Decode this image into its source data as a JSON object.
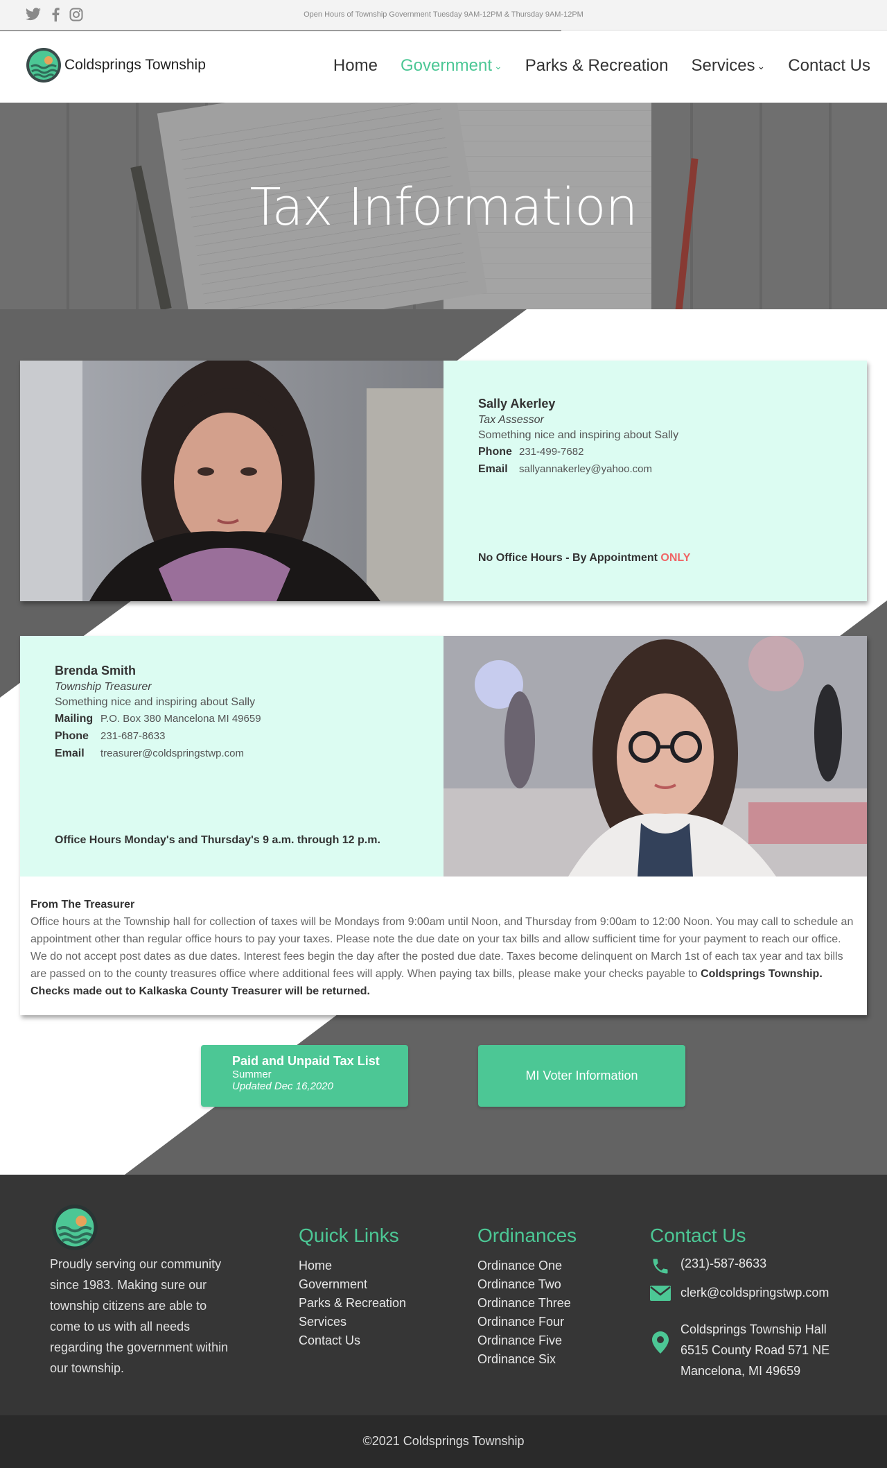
{
  "topbar": {
    "hours": "Open Hours of Township Government Tuesday 9AM-12PM & Thursday 9AM-12PM",
    "social_icons": [
      "twitter-icon",
      "facebook-icon",
      "instagram-icon"
    ]
  },
  "header": {
    "site_name": "Coldsprings Township",
    "nav": [
      {
        "label": "Home"
      },
      {
        "label": "Government"
      },
      {
        "label": "Parks & Recreation"
      },
      {
        "label": "Services"
      },
      {
        "label": "Contact Us"
      }
    ],
    "active_color": "#4cc795"
  },
  "hero": {
    "title": "Tax Information"
  },
  "assessor": {
    "name": "Sally Akerley",
    "role": "Tax Assessor",
    "desc": "Something nice and inspiring about Sally",
    "phone_label": "Phone",
    "phone": "231-499-7682",
    "email_label": "Email",
    "email": "sallyannakerley@yahoo.com",
    "hours_text": "No Office Hours - By Appointment ",
    "hours_emph": "ONLY"
  },
  "treasurer": {
    "name": "Brenda Smith",
    "role": "Township Treasurer",
    "desc": "Something nice and inspiring about Sally",
    "mailing_label": "Mailing",
    "mailing": "P.O. Box 380 Mancelona MI 49659",
    "phone_label": "Phone",
    "phone": "231-687-8633",
    "email_label": "Email",
    "email": "treasurer@coldspringstwp.com",
    "hours_text": "Office Hours Monday's and Thursday's 9 a.m. through 12 p.m."
  },
  "from_treasurer": {
    "title": "From The Treasurer",
    "body": "Office hours at the Township hall for collection of taxes will be Mondays from 9:00am until Noon, and Thursday from 9:00am to 12:00 Noon.  You may call to schedule an appointment other than regular office hours to pay your taxes. Please note the due date on your tax bills and allow sufficient time for your payment to reach our office.  We do not accept post dates as due dates.  Interest fees begin the day after the posted due date.  Taxes become delinquent on March 1st of each  tax year and tax bills are passed on to the county treasures office where additional fees will apply. When paying tax bills, please make your checks payable to ",
    "strong": "Coldsprings Township. Checks made out to Kalkaska County Treasurer will be returned."
  },
  "buttons": {
    "tax_list_title": "Paid and Unpaid Tax List",
    "tax_list_season": "Summer",
    "tax_list_updated": "Updated Dec 16,2020",
    "voter": "MI Voter Information"
  },
  "footer": {
    "about": "Proudly serving our community since 1983. Making sure our township citizens are able to come to us with all needs regarding the government within our township.",
    "quick_links_title": "Quick Links",
    "quick_links": [
      "Home",
      "Government",
      "Parks & Recreation",
      "Services",
      "Contact Us"
    ],
    "ordinances_title": "Ordinances",
    "ordinances": [
      "Ordinance One",
      "Ordinance Two",
      "Ordinance Three",
      "Ordinance Four",
      "Ordinance Five",
      "Ordinance Six"
    ],
    "contact_title": "Contact Us",
    "phone": "(231)-587-8633",
    "email": "clerk@coldspringstwp.com",
    "address_line1": "Coldsprings Township Hall",
    "address_line2": "6515 County Road 571 NE",
    "address_line3": "Mancelona, MI 49659",
    "copyright": "©2021 Coldsprings Township"
  }
}
